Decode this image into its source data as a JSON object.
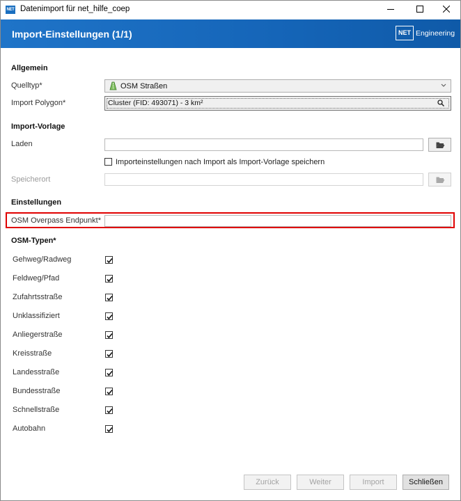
{
  "window": {
    "title": "Datenimport für net_hilfe_coep",
    "app_icon_text": "NET"
  },
  "banner": {
    "title": "Import-Einstellungen (1/1)",
    "logo_box": "NET",
    "logo_text": "Engineering"
  },
  "allgemein": {
    "heading": "Allgemein",
    "quelltyp_label": "Quelltyp*",
    "quelltyp_value": "OSM Straßen",
    "polygon_label": "Import Polygon*",
    "polygon_value": "Cluster (FID: 493071) - 3 km²"
  },
  "vorlage": {
    "heading": "Import-Vorlage",
    "laden_label": "Laden",
    "laden_value": "",
    "save_checkbox_label": "Importeinstellungen nach Import als Import-Vorlage speichern",
    "save_checked": false,
    "speicherort_label": "Speicherort",
    "speicherort_value": ""
  },
  "einstellungen": {
    "heading": "Einstellungen",
    "endpunkt_label": "OSM Overpass Endpunkt*",
    "endpunkt_value": ""
  },
  "osm_typen": {
    "heading": "OSM-Typen*",
    "items": [
      {
        "label": "Gehweg/Radweg",
        "checked": true
      },
      {
        "label": "Feldweg/Pfad",
        "checked": true
      },
      {
        "label": "Zufahrtsstraße",
        "checked": true
      },
      {
        "label": "Unklassifiziert",
        "checked": true
      },
      {
        "label": "Anliegerstraße",
        "checked": true
      },
      {
        "label": "Kreisstraße",
        "checked": true
      },
      {
        "label": "Landesstraße",
        "checked": true
      },
      {
        "label": "Bundesstraße",
        "checked": true
      },
      {
        "label": "Schnellstraße",
        "checked": true
      },
      {
        "label": "Autobahn",
        "checked": true
      }
    ]
  },
  "footer": {
    "back": "Zurück",
    "next": "Weiter",
    "import": "Import",
    "close": "Schließen"
  },
  "colors": {
    "banner": "#1565b8",
    "highlight": "#e00000"
  }
}
